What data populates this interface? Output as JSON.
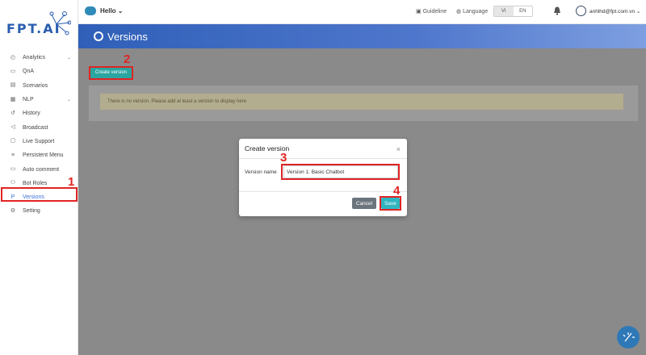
{
  "sidebar": {
    "logo_text": "FPT.AI",
    "items": [
      {
        "label": "Analytics",
        "icon": "chart-icon",
        "glyph": "◴",
        "chevron": "⌄"
      },
      {
        "label": "QnA",
        "icon": "chat-icon",
        "glyph": "▭",
        "chevron": ""
      },
      {
        "label": "Scenarios",
        "icon": "scenario-icon",
        "glyph": "▤",
        "chevron": ""
      },
      {
        "label": "NLP",
        "icon": "nlp-icon",
        "glyph": "▦",
        "chevron": "⌄"
      },
      {
        "label": "History",
        "icon": "history-icon",
        "glyph": "↺",
        "chevron": ""
      },
      {
        "label": "Broadcast",
        "icon": "broadcast-icon",
        "glyph": "◁",
        "chevron": ""
      },
      {
        "label": "Live Support",
        "icon": "support-icon",
        "glyph": "▢",
        "chevron": ""
      },
      {
        "label": "Persistent Menu",
        "icon": "menu-icon",
        "glyph": "≡",
        "chevron": ""
      },
      {
        "label": "Auto comment",
        "icon": "comment-icon",
        "glyph": "▭",
        "chevron": ""
      },
      {
        "label": "Bot Roles",
        "icon": "roles-icon",
        "glyph": "⚇",
        "chevron": ""
      },
      {
        "label": "Versions",
        "icon": "versions-icon",
        "glyph": "P",
        "chevron": ""
      },
      {
        "label": "Setting",
        "icon": "gear-icon",
        "glyph": "⚙",
        "chevron": ""
      }
    ]
  },
  "topbar": {
    "bot_name": "Hello ⌄",
    "guideline": "Guideline",
    "language": "Language",
    "lang_vi": "VI",
    "lang_en": "EN",
    "user_email": "anhlhd@fpt.com.vn ⌄"
  },
  "banner": {
    "title": "Versions"
  },
  "main": {
    "create_button": "Create version",
    "notice": "There is no version. Please add at least a version to display here"
  },
  "modal": {
    "title": "Create version",
    "close": "×",
    "label": "Version name",
    "input_value": "Version 1: Basic Chatbot",
    "cancel": "Cancel",
    "save": "Save"
  },
  "annotations": {
    "n1": "1",
    "n2": "2",
    "n3": "3",
    "n4": "4"
  },
  "colors": {
    "accent": "#2aa5a0",
    "brand": "#2f5fb8",
    "highlight": "#e02424"
  }
}
